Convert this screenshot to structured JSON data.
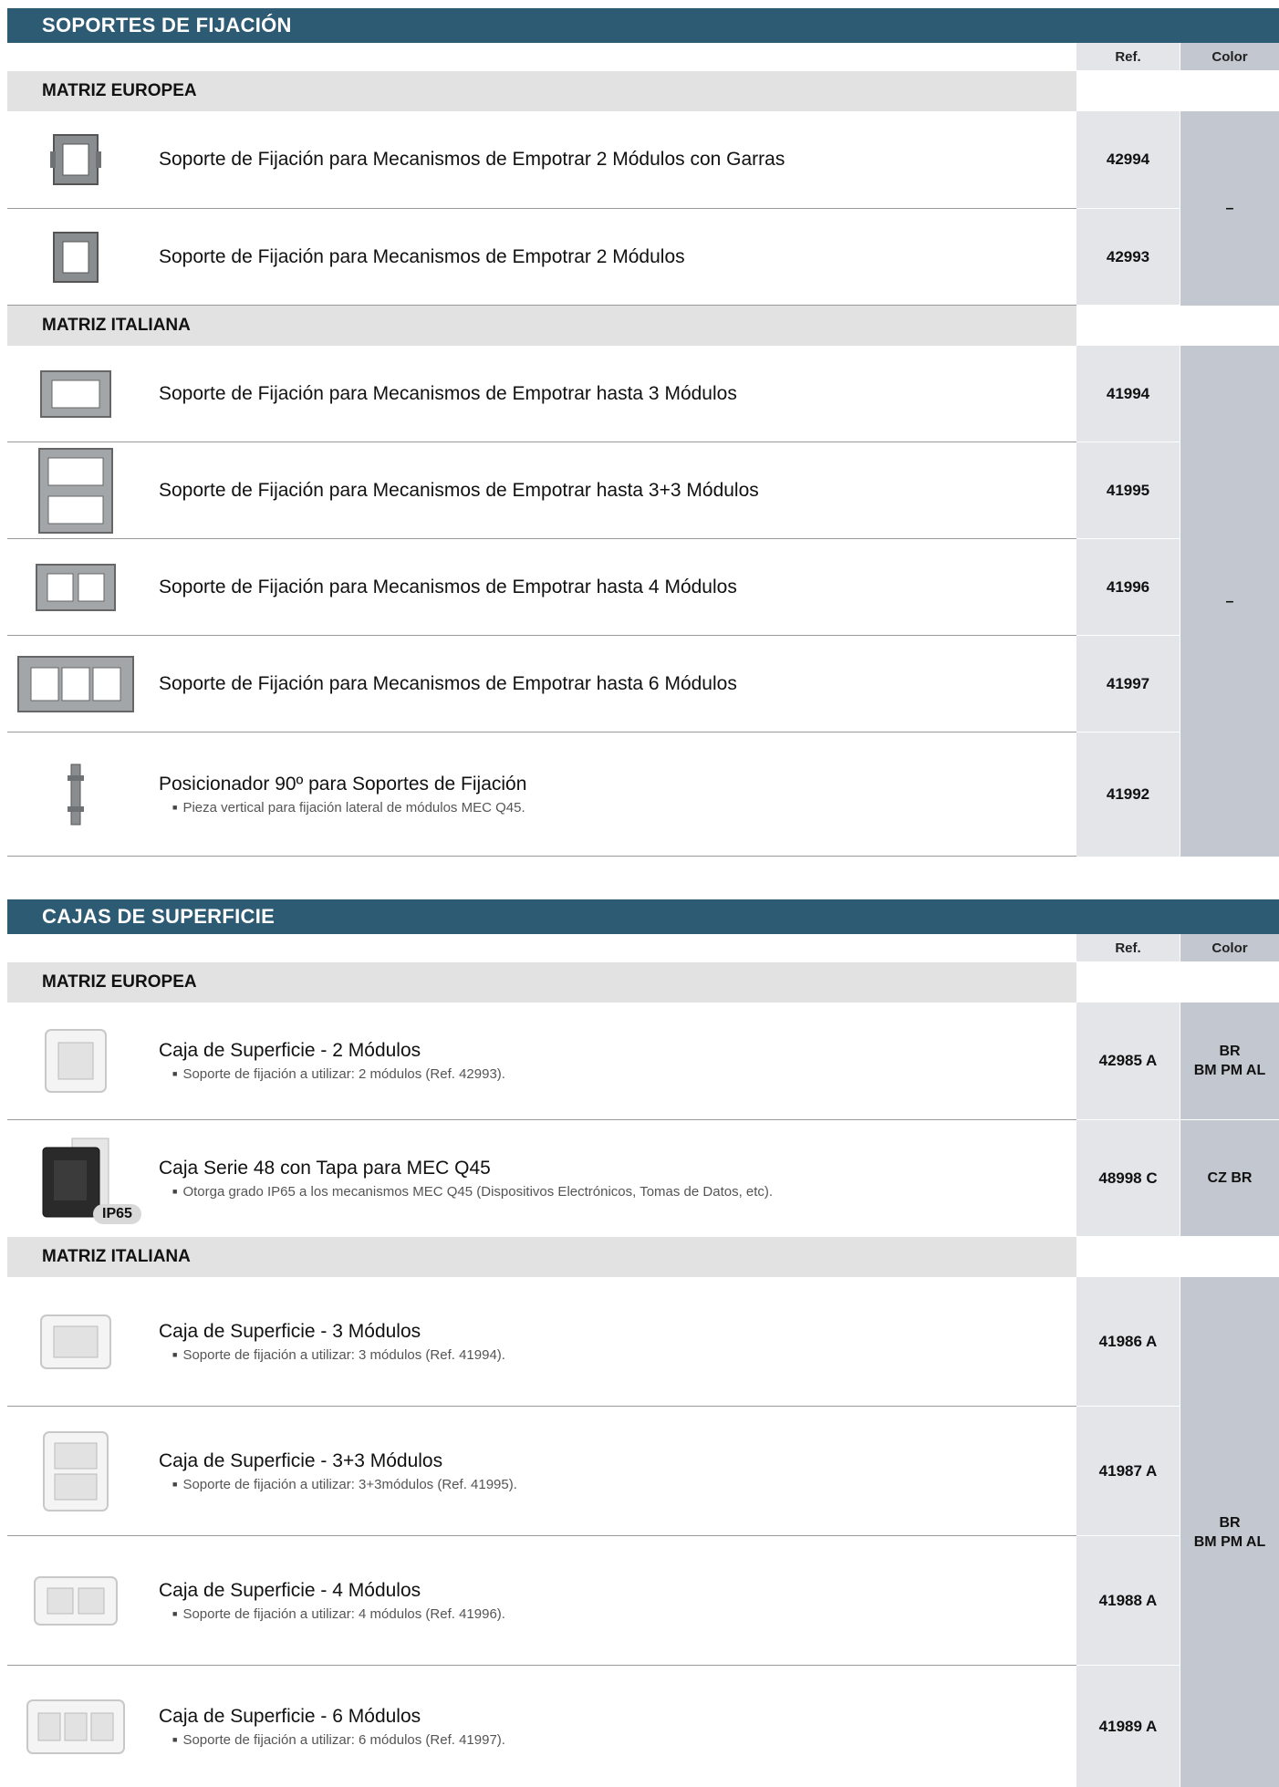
{
  "sections": [
    {
      "title": "SOPORTES DE FIJACIÓN",
      "col_ref": "Ref.",
      "col_color": "Color",
      "groups": [
        {
          "label": "MATRIZ EUROPEA",
          "color_value": [
            "–"
          ],
          "items": [
            {
              "title": "Soporte de Fijación para Mecanismos de Empotrar 2 Módulos con Garras",
              "ref": "42994"
            },
            {
              "title": "Soporte de Fijación para Mecanismos de Empotrar 2 Módulos",
              "ref": "42993"
            }
          ]
        },
        {
          "label": "MATRIZ ITALIANA",
          "color_value": [
            "–"
          ],
          "items": [
            {
              "title": "Soporte de Fijación para Mecanismos de Empotrar hasta 3 Módulos",
              "ref": "41994"
            },
            {
              "title": "Soporte de Fijación para Mecanismos de Empotrar hasta 3+3 Módulos",
              "ref": "41995"
            },
            {
              "title": "Soporte de Fijación para Mecanismos de Empotrar hasta 4 Módulos",
              "ref": "41996"
            },
            {
              "title": "Soporte de Fijación para Mecanismos de Empotrar hasta 6 Módulos",
              "ref": "41997"
            },
            {
              "title": "Posicionador 90º para Soportes de Fijación",
              "note": "Pieza vertical para fijación lateral de módulos MEC Q45.",
              "ref": "41992"
            }
          ]
        }
      ]
    },
    {
      "title": "CAJAS DE SUPERFICIE",
      "col_ref": "Ref.",
      "col_color": "Color",
      "groups": [
        {
          "label": "MATRIZ EUROPEA",
          "items": [
            {
              "title": "Caja de Superficie - 2 Módulos",
              "note": "Soporte de fijación a utilizar: 2 módulos (Ref. 42993).",
              "ref": "42985 A",
              "color": [
                "BR",
                "BM PM AL"
              ]
            },
            {
              "title": "Caja Serie 48 con Tapa para MEC Q45",
              "note": "Otorga grado IP65 a los mecanismos MEC Q45 (Dispositivos Electrónicos, Tomas de Datos, etc).",
              "ref": "48998 C",
              "color": [
                "CZ BR"
              ],
              "badge": "IP65"
            }
          ]
        },
        {
          "label": "MATRIZ ITALIANA",
          "color_value": [
            "BR",
            "BM PM AL"
          ],
          "items": [
            {
              "title": "Caja de Superficie - 3 Módulos",
              "note": "Soporte de fijación a utilizar: 3 módulos (Ref. 41994).",
              "ref": "41986 A"
            },
            {
              "title": "Caja de Superficie - 3+3 Módulos",
              "note": "Soporte de fijación a utilizar: 3+3módulos (Ref. 41995).",
              "ref": "41987 A"
            },
            {
              "title": "Caja de Superficie - 4 Módulos",
              "note": "Soporte de fijación a utilizar: 4 módulos (Ref. 41996).",
              "ref": "41988 A"
            },
            {
              "title": "Caja de Superficie - 6 Módulos",
              "note": "Soporte de fijación a utilizar: 6 módulos (Ref. 41997).",
              "ref": "41989 A"
            }
          ]
        }
      ]
    }
  ]
}
